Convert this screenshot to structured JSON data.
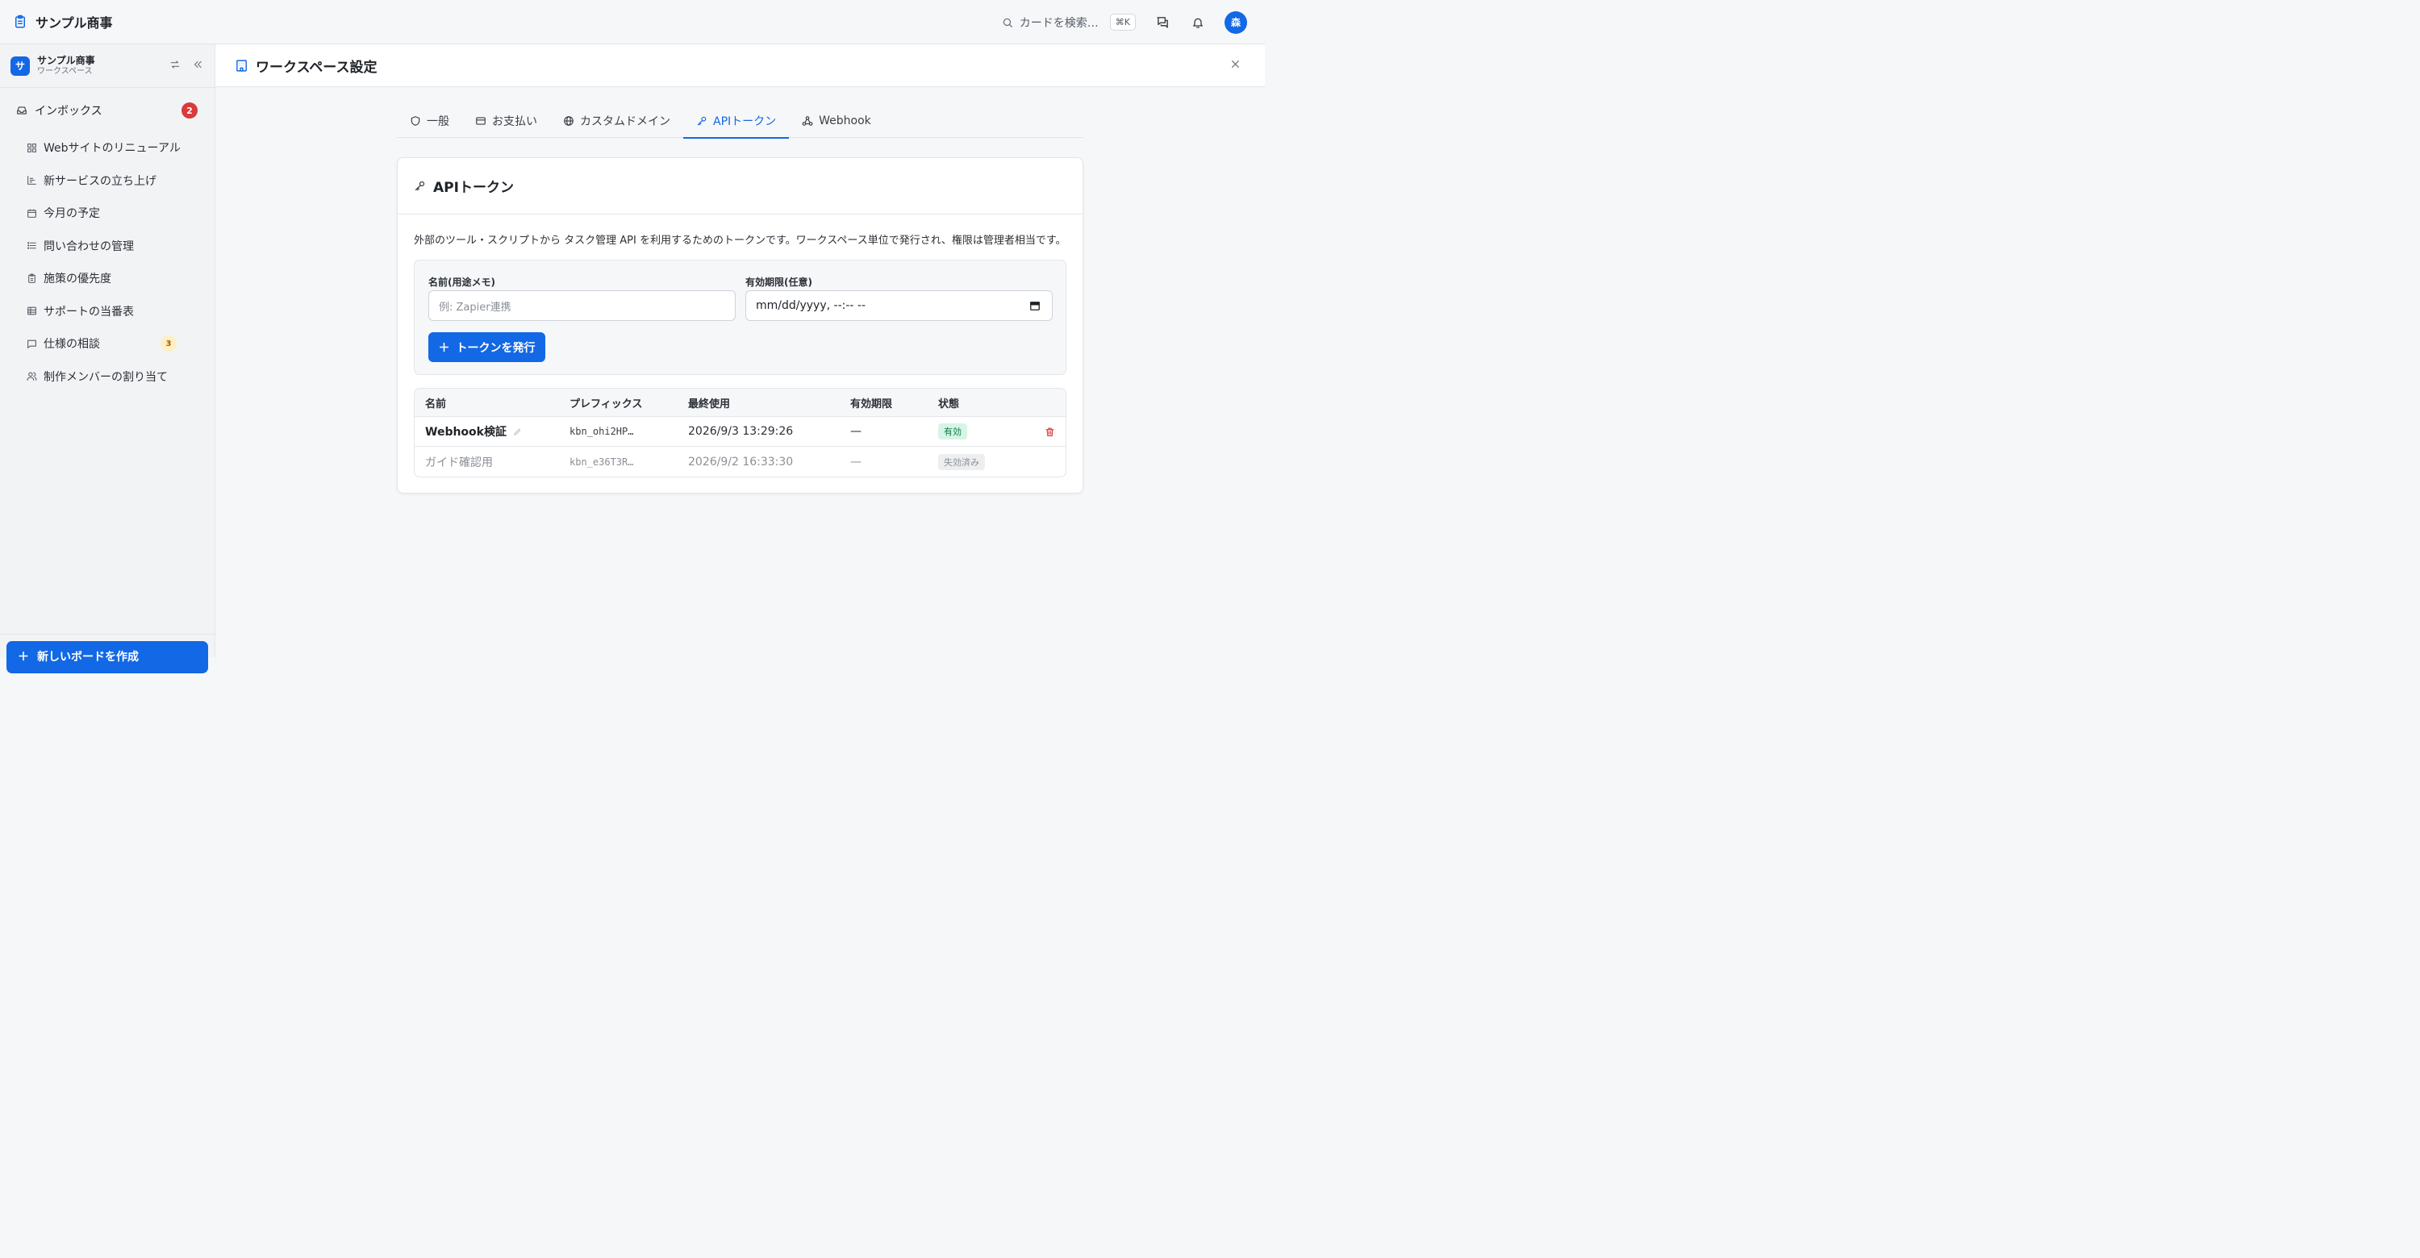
{
  "app": {
    "title": "サンプル商事"
  },
  "header": {
    "search_placeholder": "カードを検索…",
    "shortcut": "⌘K",
    "avatar_initial": "森"
  },
  "sidebar": {
    "workspace_name": "サンプル商事",
    "workspace_sub": "ワークスペース",
    "workspace_initial": "サ",
    "inbox": {
      "label": "インボックス",
      "count": "2"
    },
    "items": [
      {
        "label": "Webサイトのリニューアル",
        "icon": "board-icon"
      },
      {
        "label": "新サービスの立ち上げ",
        "icon": "chart-icon"
      },
      {
        "label": "今月の予定",
        "icon": "calendar-icon"
      },
      {
        "label": "問い合わせの管理",
        "icon": "list-icon"
      },
      {
        "label": "施策の優先度",
        "icon": "clipboard-icon"
      },
      {
        "label": "サポートの当番表",
        "icon": "table-icon"
      },
      {
        "label": "仕様の相談",
        "icon": "chat-icon",
        "badge": "3"
      },
      {
        "label": "制作メンバーの割り当て",
        "icon": "users-icon"
      }
    ],
    "new_board_label": "新しいボードを作成"
  },
  "main": {
    "title": "ワークスペース設定",
    "tabs": [
      {
        "label": "一般",
        "icon": "shield-icon"
      },
      {
        "label": "お支払い",
        "icon": "card-icon"
      },
      {
        "label": "カスタムドメイン",
        "icon": "globe-icon"
      },
      {
        "label": "APIトークン",
        "icon": "key-icon",
        "active": true
      },
      {
        "label": "Webhook",
        "icon": "webhook-icon"
      }
    ]
  },
  "api": {
    "title": "APIトークン",
    "description": "外部のツール・スクリプトから タスク管理 API を利用するためのトークンです。ワークスペース単位で発行され、権限は管理者相当です。",
    "form": {
      "name_label": "名前(用途メモ)",
      "name_placeholder": "例: Zapier連携",
      "expiry_label": "有効期限(任意)",
      "expiry_value": "mm/dd/yyyy, --:-- --",
      "issue_button": "トークンを発行"
    },
    "table": {
      "columns": [
        "名前",
        "プレフィックス",
        "最終使用",
        "有効期限",
        "状態"
      ],
      "rows": [
        {
          "name": "Webhook検証",
          "prefix": "kbn_ohi2HP…",
          "last_used": "2026/9/3 13:29:26",
          "expires": "—",
          "status": "有効"
        },
        {
          "name": "ガイド確認用",
          "prefix": "kbn_e36T3R…",
          "last_used": "2026/9/2 16:33:30",
          "expires": "—",
          "status": "失効済み"
        }
      ]
    }
  },
  "colors": {
    "accent": "#1268e5",
    "danger": "#d93a3a",
    "active_pill_bg": "#d6f5e6",
    "active_pill_fg": "#137a47"
  }
}
